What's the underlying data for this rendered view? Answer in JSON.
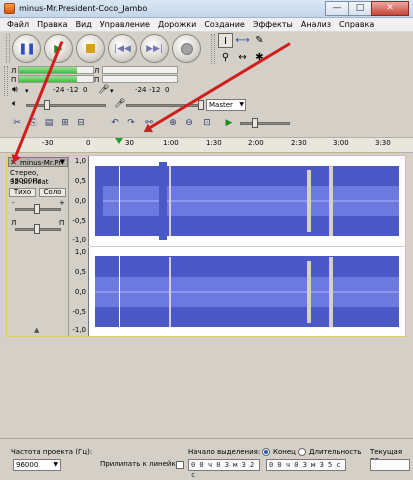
{
  "window": {
    "title": "minus-Mr.President-Coco_Jambo",
    "minimize_glyph": "—",
    "maximize_glyph": "□",
    "close_glyph": "✕"
  },
  "menu": [
    "Файл",
    "Правка",
    "Вид",
    "Управление",
    "Дорожки",
    "Создание",
    "Эффекты",
    "Анализ",
    "Справка"
  ],
  "transport": {
    "icons": [
      "pause-icon",
      "play-icon",
      "stop-icon",
      "skip-start-icon",
      "skip-end-icon",
      "record-icon"
    ]
  },
  "tools": {
    "icons": [
      "selection-tool-icon",
      "envelope-tool-icon",
      "draw-tool-icon",
      "zoom-tool-icon",
      "timeshift-tool-icon",
      "multi-tool-icon"
    ],
    "glyphs": [
      "I",
      "⟷",
      "✎",
      "⚲",
      "↔",
      "✱"
    ]
  },
  "meters": {
    "left_label": "Л",
    "right_label": "П",
    "scale_left": [
      "-24",
      "-12",
      "0"
    ],
    "scale_right": [
      "-24",
      "-12",
      "0"
    ]
  },
  "mixer": {
    "device_select": "Master"
  },
  "ruler": {
    "ticks": [
      "-30",
      "0",
      "30",
      "1:00",
      "1:30",
      "2:00",
      "2:30",
      "3:00",
      "3:30"
    ]
  },
  "track": {
    "name": "minus-Mr.Pr",
    "info_line1": "Стерео, 48000Hz",
    "info_line2": "32-bit float",
    "mute_label": "Тихо",
    "solo_label": "Соло",
    "gain_minus": "-",
    "gain_plus": "+",
    "pan_left": "Л",
    "pan_right": "П",
    "close_glyph": "✕",
    "collapse_glyph": "▲",
    "channel1_scale": [
      "1,0",
      "0,5",
      "0,0",
      "-0,5",
      "-1,0"
    ],
    "channel2_scale": [
      "1,0",
      "0,5",
      "0,0",
      "-0,5",
      "-1,0"
    ]
  },
  "bottom": {
    "rate_label": "Частота проекта (Гц):",
    "rate_value": "96000",
    "snap_label": "Прилипать к линейке",
    "selection_start_label": "Начало выделения:",
    "end_label": "Конец",
    "length_label": "Длительность",
    "current_pos_label": "Текущая по",
    "start_time": "0 0 ч 0 3 м 3 2 с",
    "end_time": "0 0 ч 0 3 м 3 5 с"
  },
  "colors": {
    "wave": "#4b59c6",
    "wave_light": "#8a98f2",
    "arrow": "#d21d1d",
    "accent": "#1e8a1e"
  }
}
